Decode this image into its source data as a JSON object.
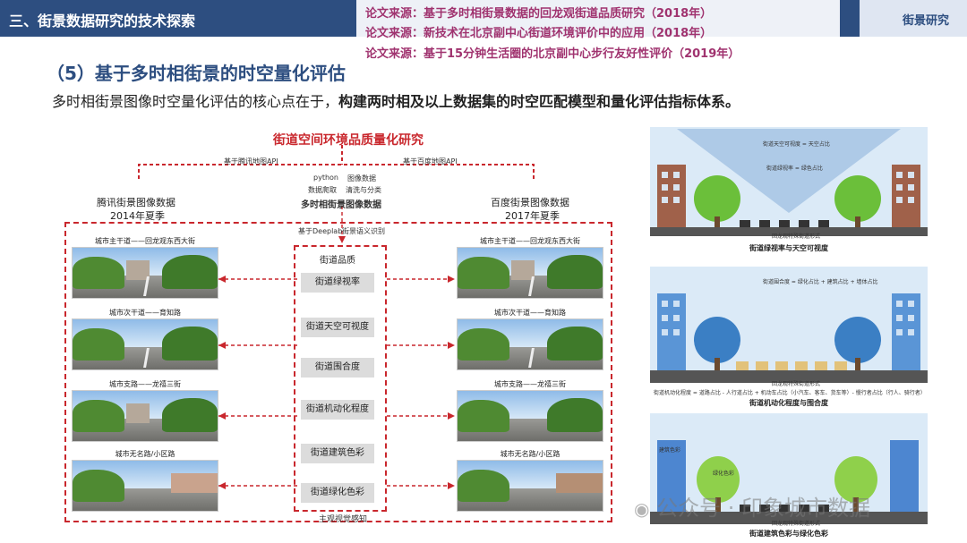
{
  "header": {
    "section": "三、街景数据研究的技术探索",
    "sources": [
      "论文来源：基于多时相街景数据的回龙观街道品质研究（2018年）",
      "论文来源：新技术在北京副中心街道环境评价中的应用（2018年）",
      "论文来源：基于15分钟生活圈的北京副中心步行友好性评价（2019年）"
    ],
    "tag": "街景研究"
  },
  "section_title": "（5）基于多时相街景的时空量化评估",
  "lead": {
    "normal": "多时相街景图像时空量化评估的核心点在于，",
    "bold": "构建两时相及以上数据集的时空匹配模型和量化评估指标体系。"
  },
  "diagram": {
    "title": "街道空间环境品质量化研究",
    "api_left": "基于腾讯地图API",
    "api_right": "基于百度地图API",
    "python": "python",
    "crawl": "数据爬取",
    "image_data": "图像数据",
    "clean": "清洗与分类",
    "multi": "多时相街景图像数据",
    "left_source": {
      "line1": "腾讯街景图像数据",
      "line2": "2014年夏季"
    },
    "right_source": {
      "line1": "百度街景图像数据",
      "line2": "2017年夏季"
    },
    "deeplab": "基于Deeplab",
    "semantic": "街景语义识别",
    "quality_header": "街道品质",
    "metrics": [
      "街道绿视率",
      "街道天空可视度",
      "街道围合度",
      "街道机动化程度",
      "街道建筑色彩",
      "街道绿化色彩"
    ],
    "street_labels": [
      "城市主干道——回龙观东西大街",
      "城市次干道——育知路",
      "城市支路——龙禧三街",
      "城市无名路/小区路"
    ],
    "bottom_label": "主观视觉感知"
  },
  "panels": [
    {
      "notes": [
        "街道天空可视度 = 天空占比",
        "街道绿视率 = 绿色占比",
        "回龙观特殊街道形式"
      ],
      "caption": "街道绿视率与天空可视度"
    },
    {
      "notes": [
        "街道围合度 = 绿化占比 + 建筑占比 + 墙体占比",
        "回龙观特殊街道形式",
        "街道机动化程度 = 道路占比 - 人行道占比 + 机动车占比（小汽车、客车、货车等）- 慢行者占比（行人、骑行者）"
      ],
      "caption": "街道机动化程度与围合度"
    },
    {
      "notes": [
        "建筑色彩",
        "绿化色彩",
        "回龙观特殊街道形式"
      ],
      "caption": "街道建筑色彩与绿化色彩"
    }
  ],
  "watermark": "公众号 · 印象城市数据",
  "colors": {
    "header_blue": "#2d4e80",
    "source_pink": "#a0336f",
    "diagram_red": "#c9272d"
  }
}
